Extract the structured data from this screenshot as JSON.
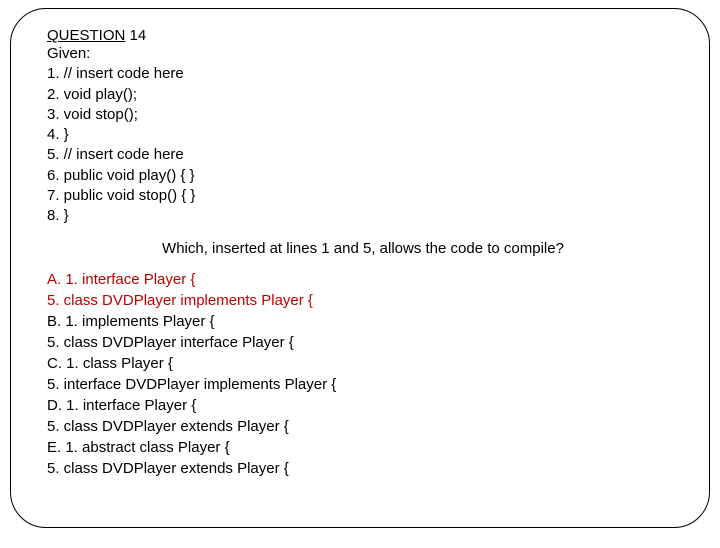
{
  "heading": {
    "label": "QUESTION",
    "number": "14"
  },
  "given_label": "Given:",
  "code_lines": {
    "l1": "1. // insert code here",
    "l2": "2. void play();",
    "l3": "3. void stop();",
    "l4": "4. }",
    "l5": "5. // insert code here",
    "l6": "6. public void play() { }",
    "l7": "7. public void stop() { }",
    "l8": "8. }"
  },
  "prompt": "Which, inserted at lines 1 and 5, allows the code to compile?",
  "answers": {
    "a1": "A. 1. interface Player {",
    "a2": "5. class DVDPlayer implements Player {",
    "b1": "B. 1. implements Player {",
    "b2": "5. class DVDPlayer interface Player {",
    "c1": "C. 1. class Player {",
    "c2": "5. interface DVDPlayer implements Player {",
    "d1": "D. 1. interface Player {",
    "d2": "5. class DVDPlayer extends Player {",
    "e1": "E. 1. abstract class Player {",
    "e2": "5. class DVDPlayer extends Player {"
  }
}
